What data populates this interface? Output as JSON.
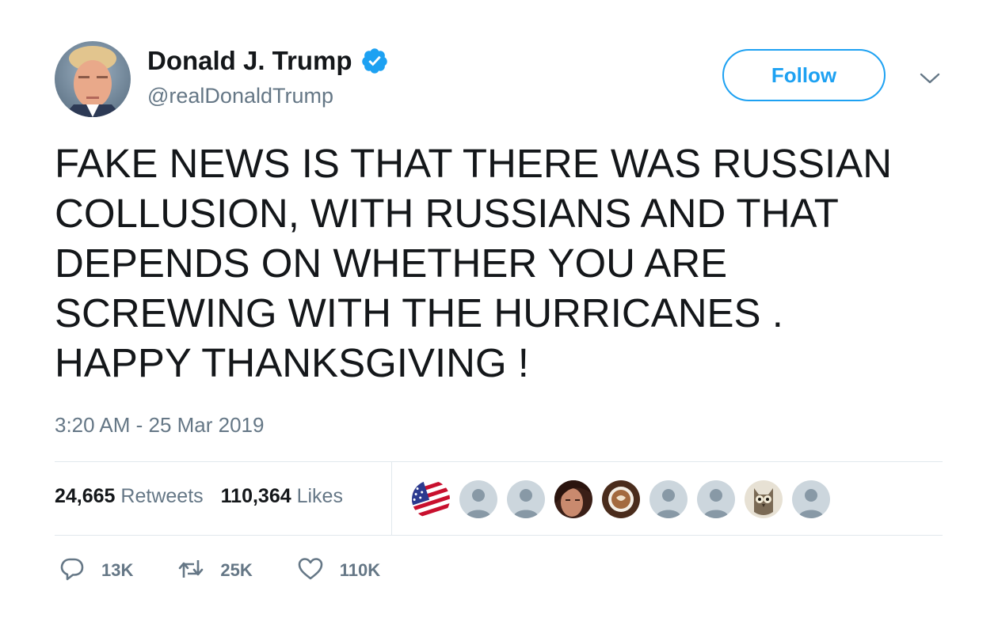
{
  "tweet": {
    "author_name": "Donald J. Trump",
    "handle": "@realDonaldTrump",
    "follow_label": "Follow",
    "text": "FAKE NEWS IS THAT THERE WAS RUSSIAN\nCOLLUSION, WITH RUSSIANS AND THAT\nDEPENDS ON WHETHER YOU ARE\nSCREWING WITH THE HURRICANES .\nHAPPY THANKSGIVING !",
    "timestamp": "3:20 AM - 25 Mar 2019"
  },
  "stats": {
    "retweets_count": "24,665",
    "retweets_label": "Retweets",
    "likes_count": "110,364",
    "likes_label": "Likes"
  },
  "likers": [
    {
      "icon": "american-flag-avatar"
    },
    {
      "icon": "default-avatar"
    },
    {
      "icon": "default-avatar"
    },
    {
      "icon": "photo-avatar-person"
    },
    {
      "icon": "photo-avatar-coffee"
    },
    {
      "icon": "default-avatar"
    },
    {
      "icon": "default-avatar"
    },
    {
      "icon": "photo-avatar-owl"
    },
    {
      "icon": "default-avatar"
    }
  ],
  "actions": {
    "reply_count": "13K",
    "retweet_count": "25K",
    "like_count": "110K"
  },
  "colors": {
    "accent": "#1da1f2",
    "secondary_text": "#657786",
    "primary_text": "#14171a",
    "divider": "#e1e8ed"
  }
}
